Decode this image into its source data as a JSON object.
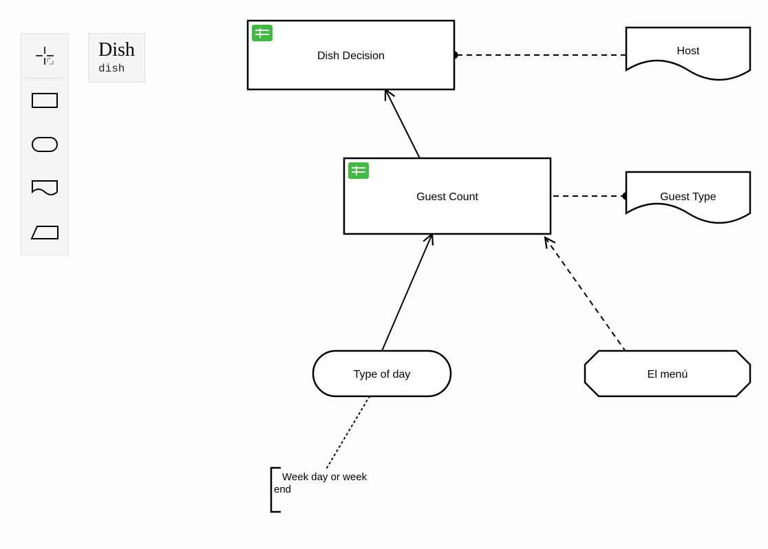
{
  "title_card": {
    "title": "Dish",
    "subtitle": "dish"
  },
  "palette": {
    "tools": [
      "move-tool",
      "rectangle-shape",
      "rounded-shape",
      "document-shape",
      "input-shape"
    ]
  },
  "nodes": {
    "dish_decision": {
      "label": "Dish Decision",
      "type": "decision-table"
    },
    "guest_count": {
      "label": "Guest Count",
      "type": "decision-table"
    },
    "host": {
      "label": "Host",
      "type": "document"
    },
    "guest_type": {
      "label": "Guest Type",
      "type": "document"
    },
    "type_of_day": {
      "label": "Type of day",
      "type": "input-rounded"
    },
    "el_menu": {
      "label": "El menú",
      "type": "knowledge-source"
    }
  },
  "annotation": {
    "line1": "Week day or week",
    "line2": "end"
  },
  "edges": [
    {
      "from": "guest_count",
      "to": "dish_decision",
      "style": "solid-arrow"
    },
    {
      "from": "type_of_day",
      "to": "guest_count",
      "style": "solid-arrow"
    },
    {
      "from": "host",
      "to": "dish_decision",
      "style": "dashed-dot"
    },
    {
      "from": "guest_type",
      "to": "guest_count",
      "style": "dashed-dot"
    },
    {
      "from": "el_menu",
      "to": "guest_count",
      "style": "dashed-open-arrow"
    },
    {
      "from": "annotation",
      "to": "type_of_day",
      "style": "dotted"
    }
  ],
  "colors": {
    "stroke": "#000000",
    "table_icon_bg": "#3fbb3f"
  }
}
